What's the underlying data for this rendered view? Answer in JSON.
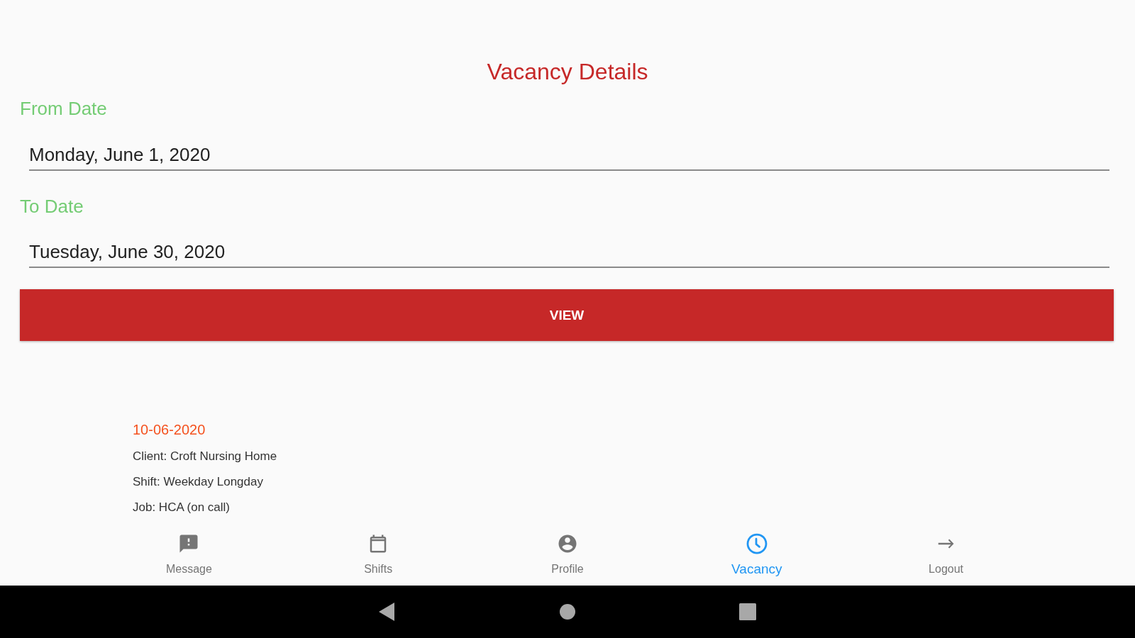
{
  "screen": {
    "title": "Vacancy Details"
  },
  "date_fields": [
    {
      "label": "From Date",
      "value": "Monday, June 1, 2020"
    },
    {
      "label": "To Date",
      "value": "Tuesday, June 30, 2020"
    }
  ],
  "view_button": {
    "label": "VIEW"
  },
  "vacancies": [
    {
      "date": "10-06-2020",
      "details": [
        "Client: Croft Nursing Home",
        "Shift: Weekday Longday",
        "Job: HCA (on call)"
      ]
    }
  ],
  "bottom_nav": [
    {
      "label": "Message",
      "selected": false
    },
    {
      "label": "Shifts",
      "selected": false
    },
    {
      "label": "Profile",
      "selected": false
    },
    {
      "label": "Vacancy",
      "selected": true
    },
    {
      "label": "Logout",
      "selected": false
    }
  ]
}
